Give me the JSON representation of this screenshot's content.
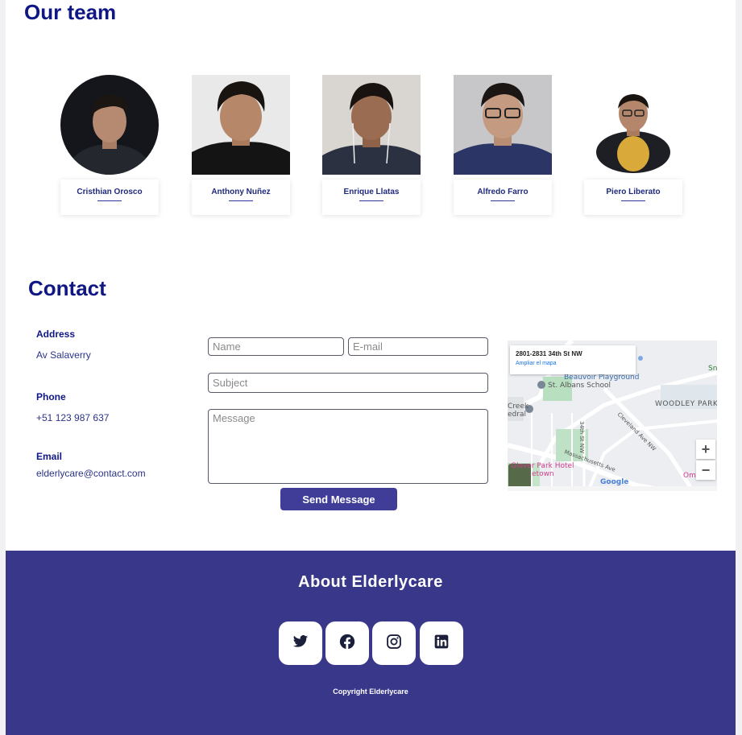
{
  "team": {
    "title": "Our team",
    "members": [
      {
        "name": "Cristhian Orosco"
      },
      {
        "name": "Anthony Nuñez"
      },
      {
        "name": "Enrique Llatas"
      },
      {
        "name": "Alfredo Farro"
      },
      {
        "name": "Piero Liberato"
      }
    ]
  },
  "contact": {
    "title": "Contact",
    "address_label": "Address",
    "address_value": "Av Salaverry",
    "phone_label": "Phone",
    "phone_value": "+51 123 987 637",
    "email_label": "Email",
    "email_value": "elderlycare@contact.com",
    "form": {
      "name_placeholder": "Name",
      "email_placeholder": "E-mail",
      "subject_placeholder": "Subject",
      "message_placeholder": "Message",
      "send_label": "Send Message"
    },
    "map": {
      "address": "2801-2831 34th St NW",
      "link": "Ampliar el mapa",
      "labels": {
        "playground": "Beauvoir Playground",
        "school": "St. Albans School",
        "woodley": "WOODLEY PARK",
        "cleveland": "Cleveland Ave NW",
        "massachusetts": "Massachusetts Ave",
        "hotel": "Glover Park Hotel",
        "town": "etown",
        "google": "Google",
        "cathedral_1": "Creek",
        "cathedral_2": "edral",
        "street_34": "34th St NW",
        "omni": "Omni",
        "sn": "Sn"
      },
      "zoom_in": "+",
      "zoom_out": "−"
    }
  },
  "footer": {
    "title": "About Elderlycare",
    "social": [
      {
        "icon": "twitter-icon"
      },
      {
        "icon": "facebook-icon"
      },
      {
        "icon": "instagram-icon"
      },
      {
        "icon": "linkedin-icon"
      }
    ],
    "copyright": "Copyright Elderlycare"
  },
  "colors": {
    "accent": "#0f1785",
    "footer": "#383789",
    "button": "#3f3d97"
  }
}
